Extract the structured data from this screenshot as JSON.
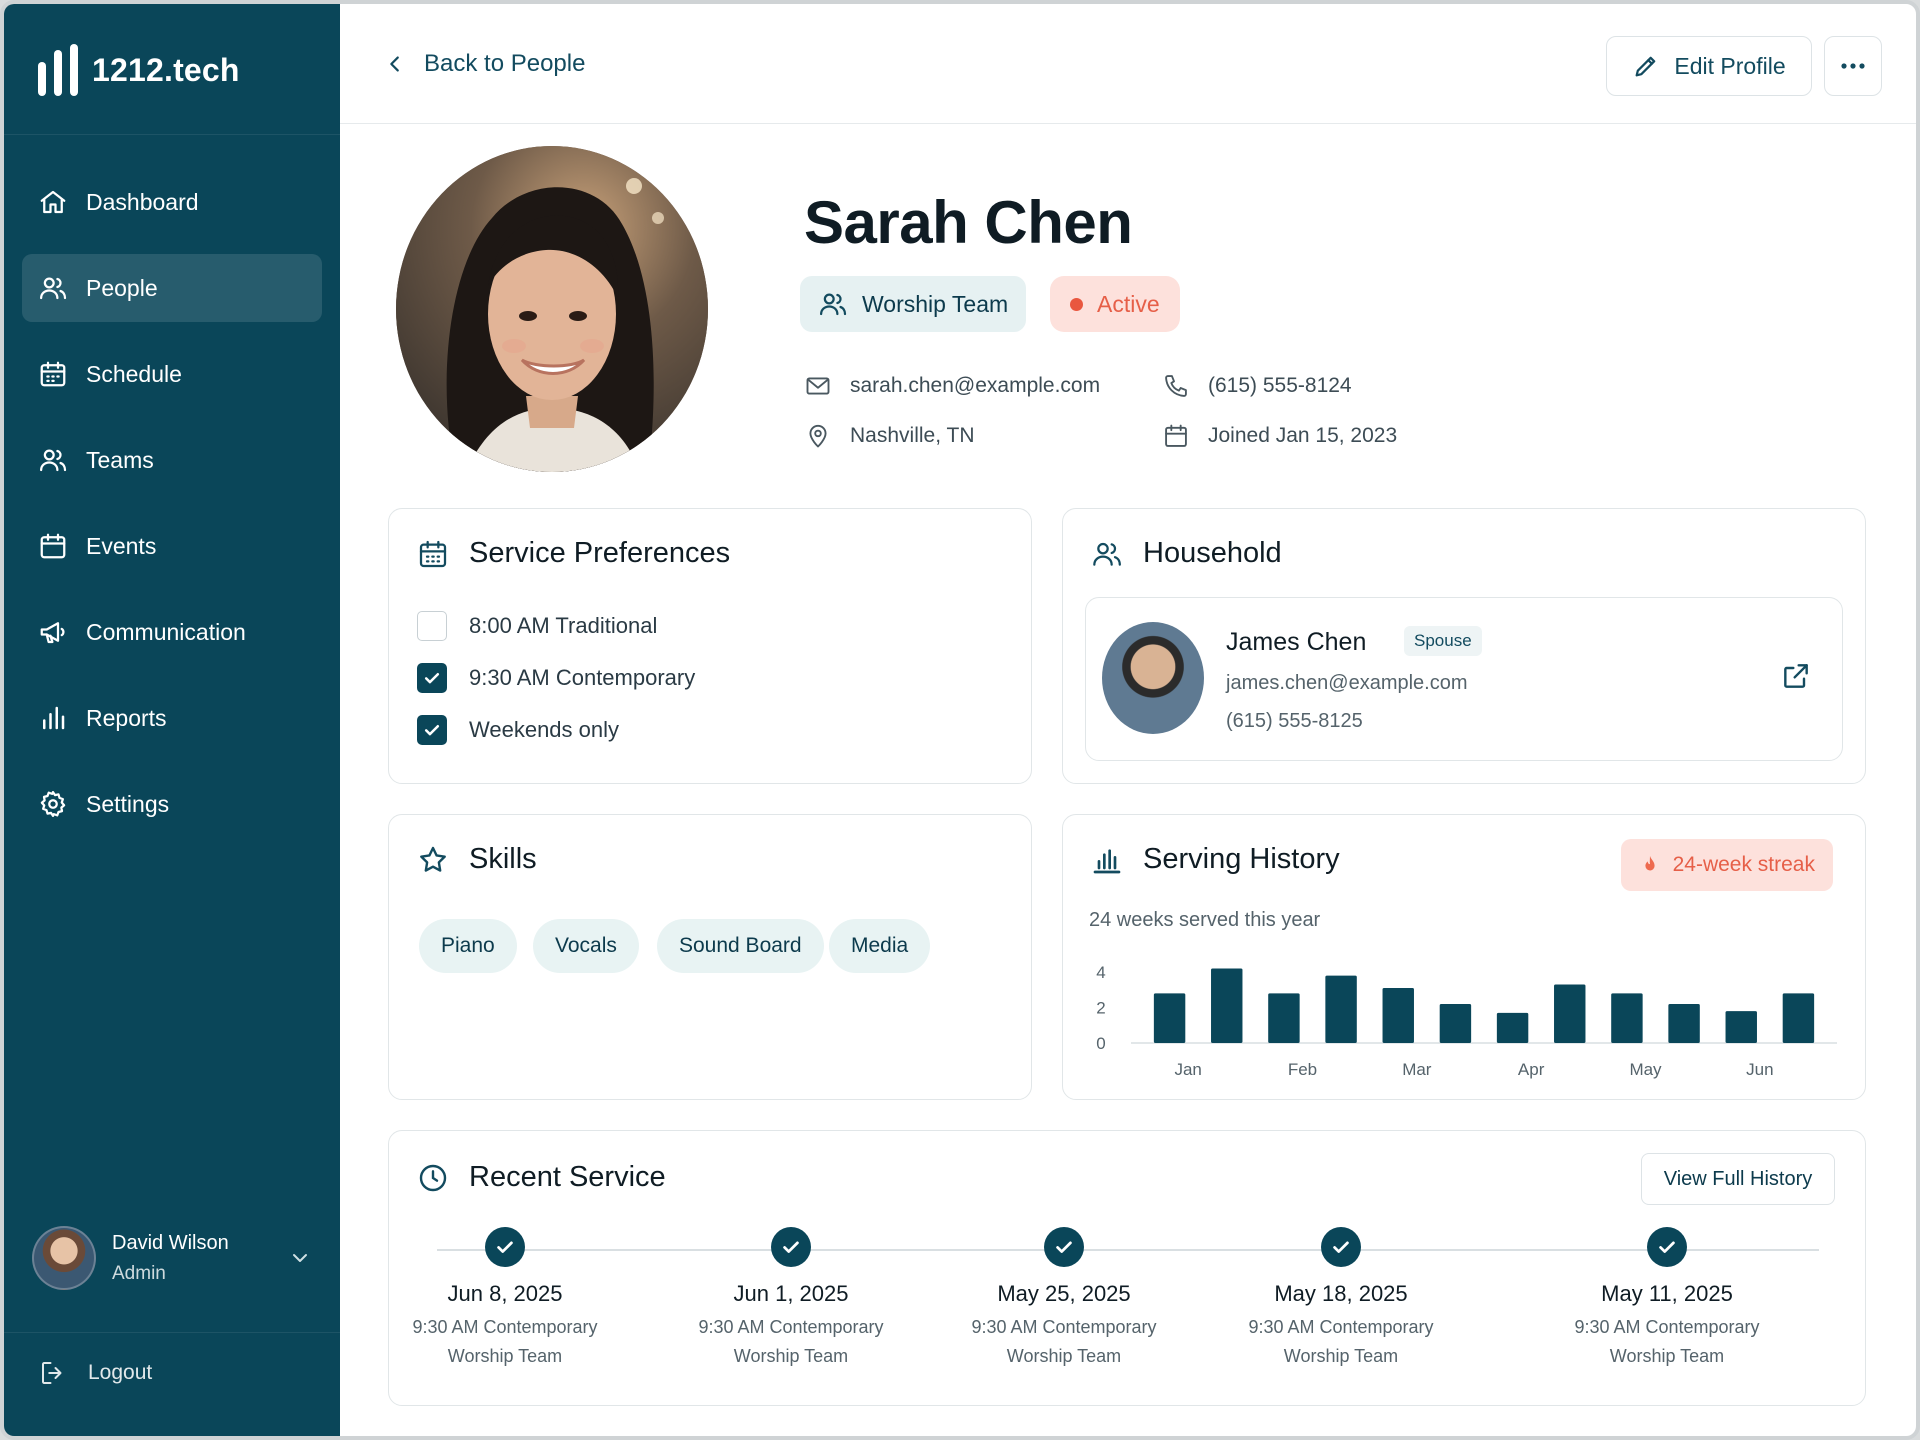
{
  "brand": {
    "name": "1212.tech"
  },
  "nav": {
    "items": [
      {
        "label": "Dashboard",
        "icon": "home-icon",
        "active": false
      },
      {
        "label": "People",
        "icon": "users-icon",
        "active": true
      },
      {
        "label": "Schedule",
        "icon": "calendar-grid-icon",
        "active": false
      },
      {
        "label": "Teams",
        "icon": "users-icon",
        "active": false
      },
      {
        "label": "Events",
        "icon": "calendar-icon",
        "active": false
      },
      {
        "label": "Communication",
        "icon": "megaphone-icon",
        "active": false
      },
      {
        "label": "Reports",
        "icon": "bar-chart-icon",
        "active": false
      },
      {
        "label": "Settings",
        "icon": "gear-icon",
        "active": false
      }
    ]
  },
  "user": {
    "name": "David Wilson",
    "role": "Admin"
  },
  "logout": {
    "label": "Logout"
  },
  "header": {
    "back_label": "Back to People",
    "edit_label": "Edit Profile"
  },
  "profile": {
    "name": "Sarah Chen",
    "team": "Worship Team",
    "status": "Active",
    "email": "sarah.chen@example.com",
    "phone": "(615) 555-8124",
    "location": "Nashville, TN",
    "joined": "Joined Jan 15, 2023"
  },
  "preferences": {
    "title": "Service Preferences",
    "items": [
      {
        "label": "8:00 AM Traditional",
        "checked": false
      },
      {
        "label": "9:30 AM Contemporary",
        "checked": true
      },
      {
        "label": "Weekends only",
        "checked": true
      }
    ]
  },
  "household": {
    "title": "Household",
    "member": {
      "name": "James Chen",
      "relation": "Spouse",
      "email": "james.chen@example.com",
      "phone": "(615) 555-8125"
    }
  },
  "skills": {
    "title": "Skills",
    "items": [
      "Piano",
      "Vocals",
      "Sound Board",
      "Media"
    ]
  },
  "serving": {
    "title": "Serving History",
    "streak": "24-week streak",
    "subtitle": "24 weeks served this year"
  },
  "chart_data": {
    "type": "bar",
    "x_labels": [
      "Jan",
      "Feb",
      "Mar",
      "Apr",
      "May",
      "Jun"
    ],
    "values": [
      2.8,
      4.2,
      2.8,
      3.8,
      3.1,
      2.2,
      1.7,
      3.3,
      2.8,
      2.2,
      1.8,
      2.8
    ],
    "ylim": [
      0,
      4.4
    ],
    "yticks": [
      0,
      2,
      4
    ],
    "color": "#0a4659",
    "grid": false
  },
  "recent": {
    "title": "Recent Service",
    "view_label": "View Full History",
    "items": [
      {
        "date": "Jun 8, 2025",
        "service": "9:30 AM Contemporary",
        "team": "Worship Team"
      },
      {
        "date": "Jun 1, 2025",
        "service": "9:30 AM Contemporary",
        "team": "Worship Team"
      },
      {
        "date": "May 25, 2025",
        "service": "9:30 AM Contemporary",
        "team": "Worship Team"
      },
      {
        "date": "May 18, 2025",
        "service": "9:30 AM Contemporary",
        "team": "Worship Team"
      },
      {
        "date": "May 11, 2025",
        "service": "9:30 AM Contemporary",
        "team": "Worship Team"
      }
    ]
  },
  "colors": {
    "sidebar": "#0a4659",
    "accent": "#0a4659",
    "status": "#e9573f",
    "status_bg": "#fde1dc"
  }
}
